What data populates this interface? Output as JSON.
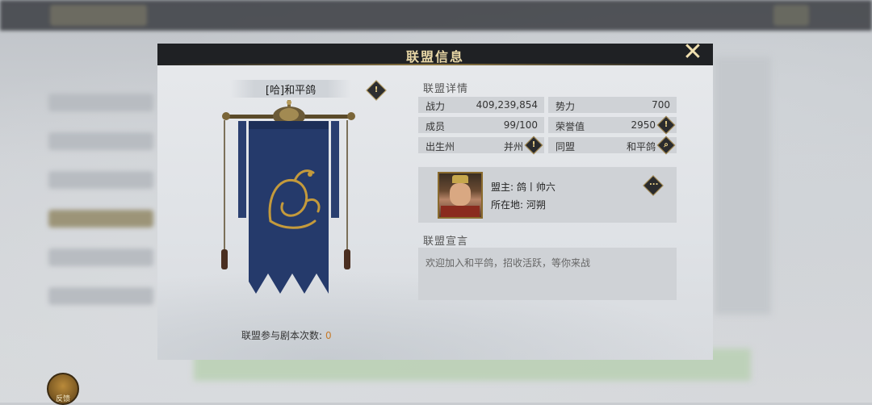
{
  "dialog": {
    "title": "联盟信息",
    "close_icon": "close-icon"
  },
  "alliance": {
    "name": "[哈]和平鸽",
    "participation_label": "联盟参与剧本次数:",
    "participation_value": "0"
  },
  "details": {
    "section_title": "联盟详情",
    "power_label": "战力",
    "power_value": "409,239,854",
    "influence_label": "势力",
    "influence_value": "700",
    "members_label": "成员",
    "members_value": "99/100",
    "honor_label": "荣誉值",
    "honor_value": "2950",
    "birth_state_label": "出生州",
    "birth_state_value": "并州",
    "ally_label": "同盟",
    "ally_value": "和平鸽"
  },
  "leader": {
    "leader_text": "盟主: 鸽丨帅六",
    "location_text": "所在地: 河朔"
  },
  "declaration": {
    "section_title": "联盟宣言",
    "text": "欢迎加入和平鸽，招收活跃，等你来战"
  },
  "background": {
    "badge_text": "反馈"
  },
  "colors": {
    "title_gold": "#e8d7a6",
    "flag_blue": "#253a6b",
    "emblem_gold": "#c49a3c",
    "accent_orange": "#c77a2a"
  }
}
